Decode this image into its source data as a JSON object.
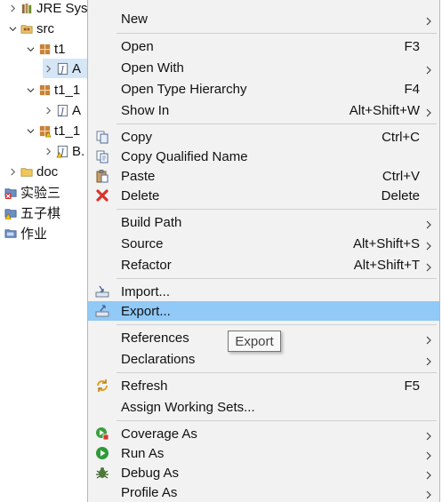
{
  "tree": {
    "rows": [
      {
        "label": "JRE Syst"
      },
      {
        "label": "src"
      },
      {
        "label": "t1"
      },
      {
        "label": "A"
      },
      {
        "label": "t1_1"
      },
      {
        "label": "A"
      },
      {
        "label": "t1_1"
      },
      {
        "label": "B."
      },
      {
        "label": "doc"
      },
      {
        "label": "实验三"
      },
      {
        "label": "五子棋"
      },
      {
        "label": "作业"
      }
    ]
  },
  "menu": {
    "new": {
      "label": "New"
    },
    "open": {
      "label": "Open",
      "shortcut": "F3"
    },
    "open_with": {
      "label": "Open With"
    },
    "open_type_hierarchy": {
      "label": "Open Type Hierarchy",
      "shortcut": "F4"
    },
    "show_in": {
      "label": "Show In",
      "shortcut": "Alt+Shift+W"
    },
    "copy": {
      "label": "Copy",
      "shortcut": "Ctrl+C"
    },
    "copy_qualified_name": {
      "label": "Copy Qualified Name"
    },
    "paste": {
      "label": "Paste",
      "shortcut": "Ctrl+V"
    },
    "delete": {
      "label": "Delete",
      "shortcut": "Delete"
    },
    "build_path": {
      "label": "Build Path"
    },
    "source": {
      "label": "Source",
      "shortcut": "Alt+Shift+S"
    },
    "refactor": {
      "label": "Refactor",
      "shortcut": "Alt+Shift+T"
    },
    "import": {
      "label": "Import..."
    },
    "export": {
      "label": "Export..."
    },
    "references": {
      "label": "References"
    },
    "declarations": {
      "label": "Declarations"
    },
    "refresh": {
      "label": "Refresh",
      "shortcut": "F5"
    },
    "assign_working_sets": {
      "label": "Assign Working Sets..."
    },
    "coverage_as": {
      "label": "Coverage As"
    },
    "run_as": {
      "label": "Run As"
    },
    "debug_as": {
      "label": "Debug As"
    },
    "profile_as": {
      "label": "Profile As"
    }
  },
  "tooltip": {
    "text": "Export"
  },
  "colors": {
    "highlight": "#91c9f7",
    "menu_bg": "#f2f2f2",
    "selection": "#d5e6f6"
  }
}
